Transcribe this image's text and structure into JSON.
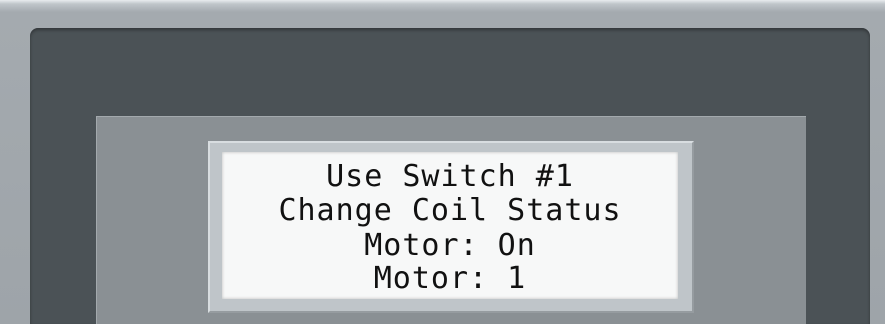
{
  "display": {
    "lines": [
      "Use Switch #1",
      "Change Coil Status",
      "Motor: On",
      "Motor: 1"
    ]
  },
  "colors": {
    "panel_frame": "#9ea4a9",
    "outer_bezel": "#4b5256",
    "inner_bezel": "#8a9094",
    "lcd_background": "#f7f8f8",
    "lcd_text": "#111111"
  }
}
